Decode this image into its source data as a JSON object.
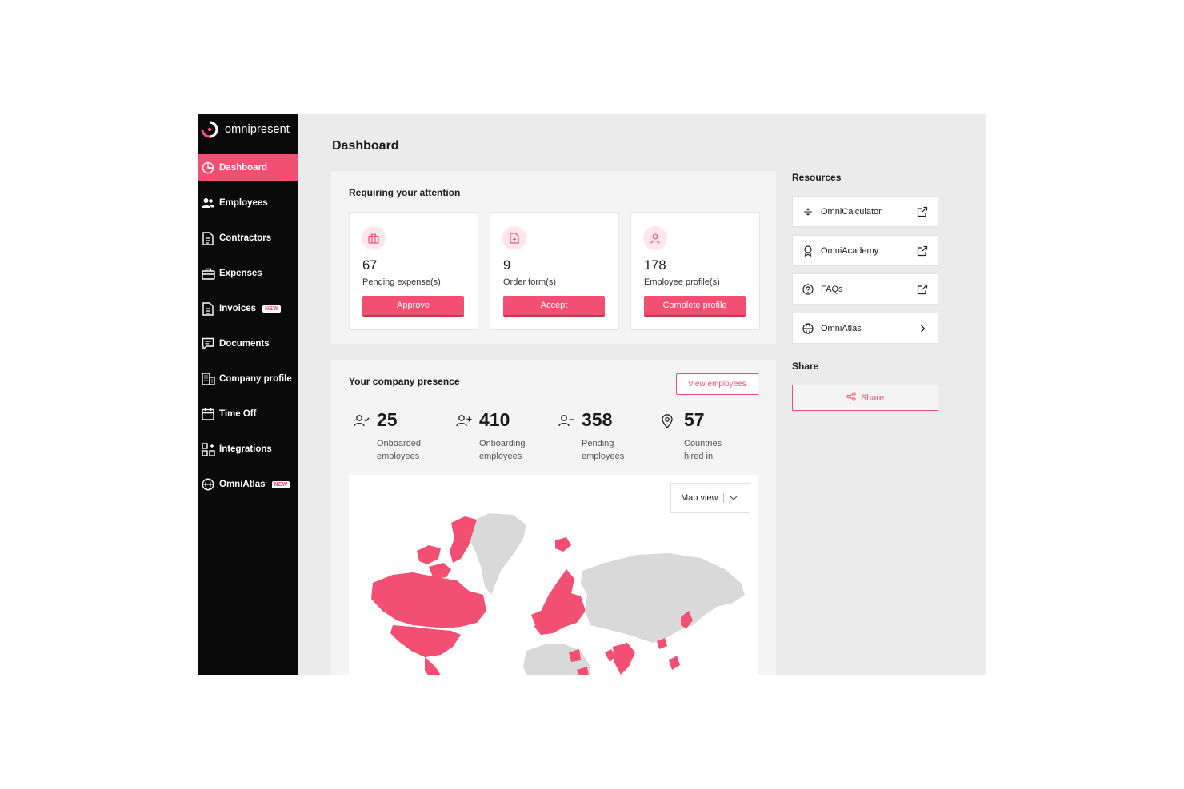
{
  "brand": {
    "name": "omnipresent",
    "accent": "#f24f72",
    "sidebar_bg": "#0a0a0a"
  },
  "sidebar": {
    "items": [
      {
        "label": "Dashboard",
        "icon": "pie-chart-icon",
        "active": true
      },
      {
        "label": "Employees",
        "icon": "users-icon"
      },
      {
        "label": "Contractors",
        "icon": "document-icon"
      },
      {
        "label": "Expenses",
        "icon": "briefcase-icon"
      },
      {
        "label": "Invoices",
        "icon": "invoice-icon",
        "badge": "NEW"
      },
      {
        "label": "Documents",
        "icon": "message-doc-icon"
      },
      {
        "label": "Company profile",
        "icon": "building-icon"
      },
      {
        "label": "Time Off",
        "icon": "calendar-icon"
      },
      {
        "label": "Integrations",
        "icon": "grid-plus-icon"
      },
      {
        "label": "OmniAtlas",
        "icon": "globe-icon",
        "badge": "NEW"
      }
    ]
  },
  "page": {
    "title": "Dashboard"
  },
  "attention": {
    "title": "Requiring your attention",
    "cards": [
      {
        "count": "67",
        "label": "Pending expense(s)",
        "button": "Approve",
        "icon": "briefcase-icon"
      },
      {
        "count": "9",
        "label": "Order form(s)",
        "button": "Accept",
        "icon": "file-icon"
      },
      {
        "count": "178",
        "label": "Employee profile(s)",
        "button": "Complete profile",
        "icon": "user-icon"
      }
    ]
  },
  "presence": {
    "title": "Your company presence",
    "view_button": "View employees",
    "stats": [
      {
        "value": "25",
        "label_line1": "Onboarded",
        "label_line2": "employees",
        "icon": "user-check-icon"
      },
      {
        "value": "410",
        "label_line1": "Onboarding",
        "label_line2": "employees",
        "icon": "user-plus-icon"
      },
      {
        "value": "358",
        "label_line1": "Pending",
        "label_line2": "employees",
        "icon": "user-minus-icon"
      },
      {
        "value": "57",
        "label_line1": "Countries",
        "label_line2": "hired in",
        "icon": "location-pin-icon"
      }
    ],
    "map_view": "Map view"
  },
  "resources": {
    "title": "Resources",
    "items": [
      {
        "label": "OmniCalculator",
        "icon": "calculator-icon",
        "action": "external-link-icon"
      },
      {
        "label": "OmniAcademy",
        "icon": "award-icon",
        "action": "external-link-icon"
      },
      {
        "label": "FAQs",
        "icon": "help-circle-icon",
        "action": "external-link-icon"
      },
      {
        "label": "OmniAtlas",
        "icon": "globe-icon",
        "action": "chevron-right-icon"
      }
    ]
  },
  "share": {
    "title": "Share",
    "button": "Share"
  }
}
